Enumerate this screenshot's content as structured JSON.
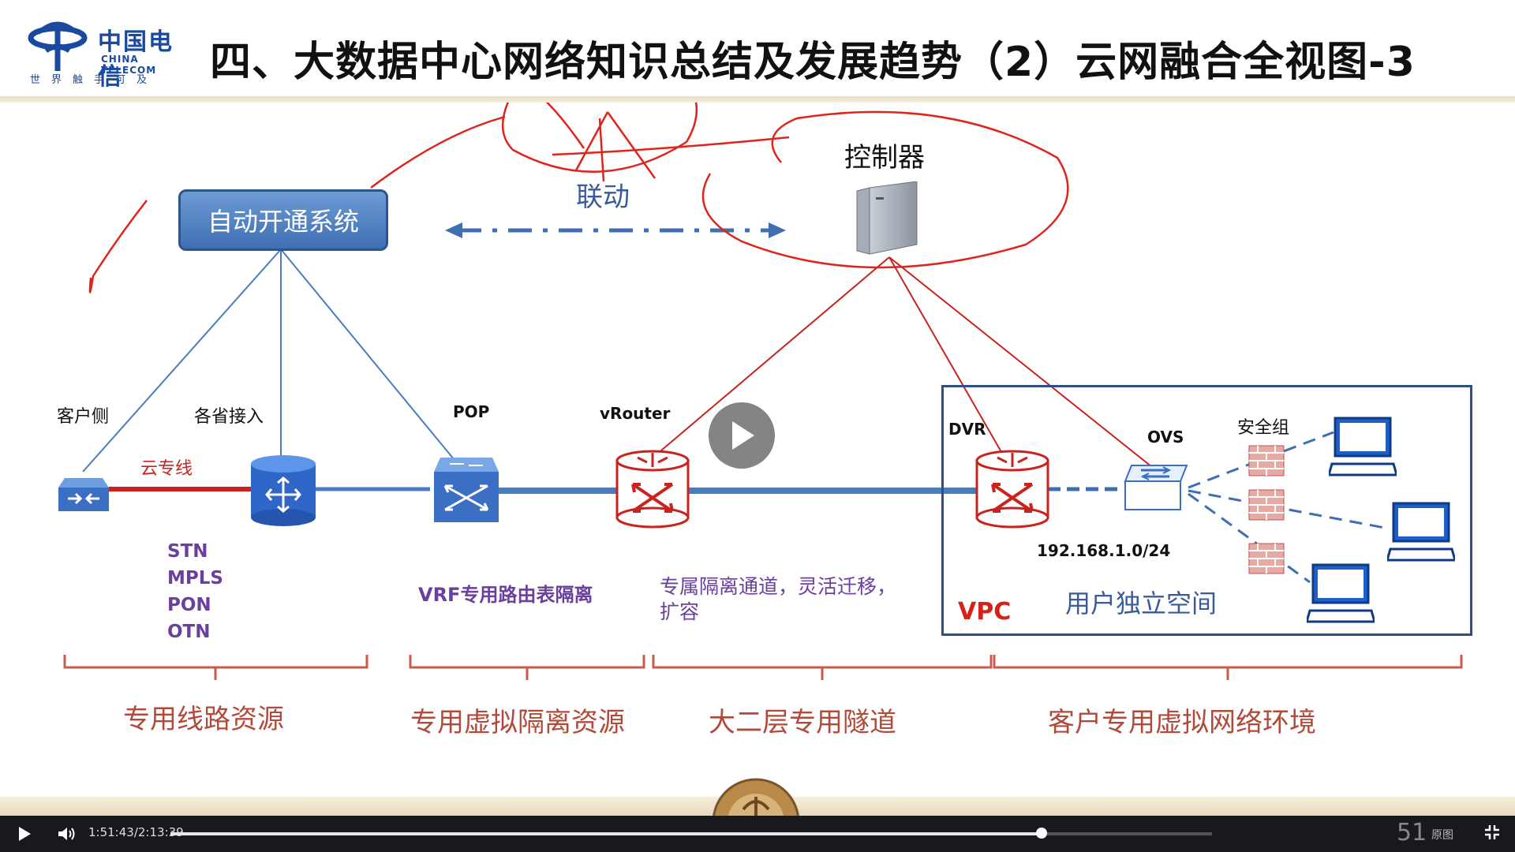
{
  "header": {
    "logo_cn": "中国电信",
    "logo_en": "CHINA TELECOM",
    "logo_sub": "世界触手可及",
    "title": "四、大数据中心网络知识总结及发展趋势（2）云网融合全视图-3"
  },
  "diagram": {
    "auto_system": "自动开通系统",
    "controller": "控制器",
    "linkage": "联动",
    "labels": {
      "customer_side": "客户侧",
      "province_access": "各省接入",
      "pop": "POP",
      "vrouter": "vRouter",
      "dvr": "DVR",
      "ovs": "OVS",
      "security_group": "安全组",
      "cloud_line": "云专线",
      "subnet": "192.168.1.0/24",
      "vpc": "VPC",
      "user_space": "用户独立空间"
    },
    "access_types": [
      "STN",
      "MPLS",
      "PON",
      "OTN"
    ],
    "vrf_text": "VRF专用路由表隔离",
    "tunnel_text_line1": "专属隔离通道，灵活迁移，",
    "tunnel_text_line2": "扩容",
    "sections": [
      "专用线路资源",
      "专用虚拟隔离资源",
      "大二层专用隧道",
      "客户专用虚拟网络环境"
    ],
    "colors": {
      "blue_line": "#4a7cc0",
      "red_line": "#c8231e",
      "purple_text": "#6b3fa0",
      "brown_text": "#b24a3a"
    }
  },
  "player": {
    "time": "1:51:43/2:13:39",
    "progress": 0.836,
    "page_number": "51",
    "original_label": "原图"
  }
}
